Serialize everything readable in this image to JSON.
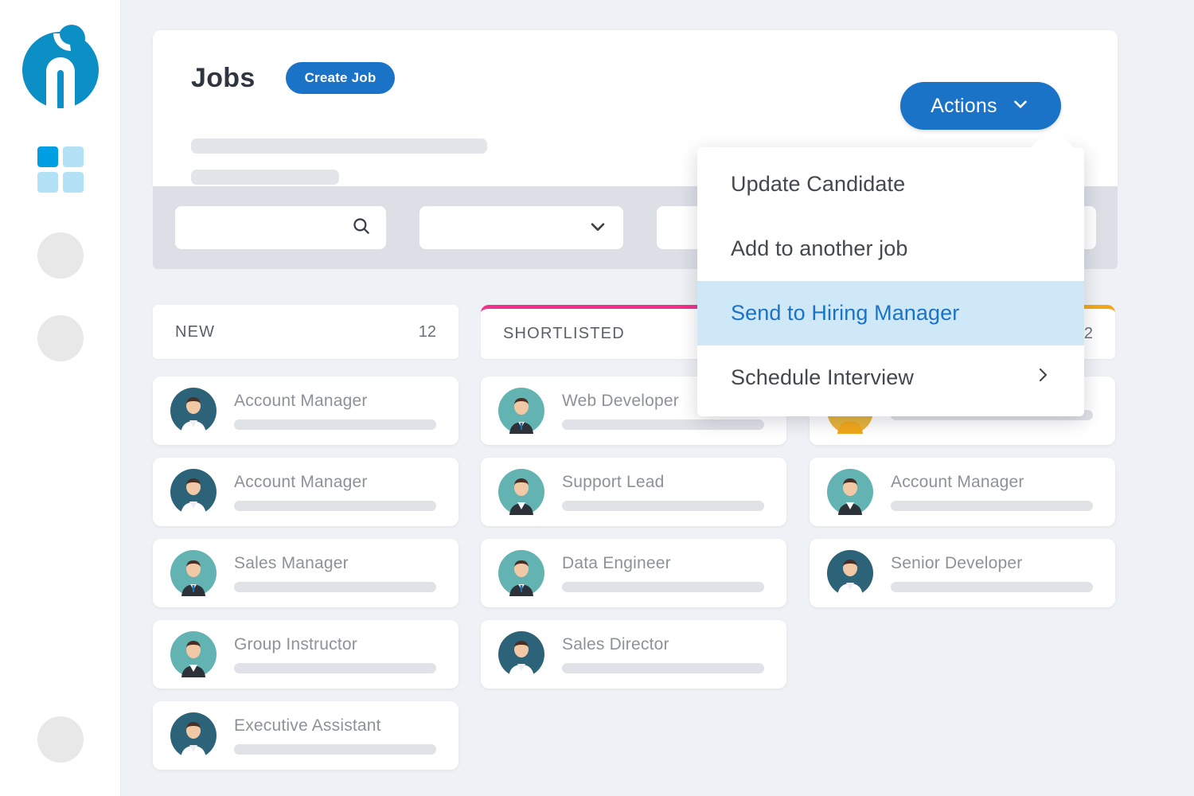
{
  "sidebar": {
    "logo_name": "recruiter-logo",
    "items": [
      {
        "name": "apps-grid-icon",
        "type": "grid"
      },
      {
        "name": "nav-placeholder-1",
        "type": "dot"
      },
      {
        "name": "nav-placeholder-2",
        "type": "dot"
      },
      {
        "name": "nav-placeholder-3",
        "type": "dot"
      }
    ]
  },
  "header": {
    "title": "Jobs",
    "create_job_label": "Create Job"
  },
  "filters": {
    "search_placeholder": "",
    "search_value": "",
    "search_icon": "search-icon",
    "select_value": "",
    "select_icon": "chevron-down-icon",
    "third_value": "",
    "fourth_value": ""
  },
  "actions": {
    "label": "Actions",
    "chevron": "chevron-down-icon",
    "menu": [
      {
        "label": "Update Candidate",
        "active": false,
        "submenu": false
      },
      {
        "label": "Add to another job",
        "active": false,
        "submenu": false
      },
      {
        "label": "Send to Hiring Manager",
        "active": true,
        "submenu": false
      },
      {
        "label": "Schedule Interview",
        "active": false,
        "submenu": true,
        "submenu_icon": "chevron-right-icon"
      }
    ]
  },
  "board": {
    "columns": [
      {
        "name": "NEW",
        "count": "12",
        "accent": "none",
        "cards": [
          {
            "title": "Account Manager",
            "avatar_bg": "#2d6379",
            "avatar_type": "female"
          },
          {
            "title": "Account Manager",
            "avatar_bg": "#2d6379",
            "avatar_type": "female"
          },
          {
            "title": "Sales Manager",
            "avatar_bg": "#62b3b2",
            "avatar_type": "male"
          },
          {
            "title": "Group Instructor",
            "avatar_bg": "#62b3b2",
            "avatar_type": "female"
          },
          {
            "title": "Executive Assistant",
            "avatar_bg": "#2d6379",
            "avatar_type": "female"
          }
        ]
      },
      {
        "name": "SHORTLISTED",
        "count": "",
        "accent": "#f0328c",
        "cards": [
          {
            "title": "Web Developer",
            "avatar_bg": "#62b3b2",
            "avatar_type": "male"
          },
          {
            "title": "Support Lead",
            "avatar_bg": "#62b3b2",
            "avatar_type": "female"
          },
          {
            "title": "Data Engineer",
            "avatar_bg": "#62b3b2",
            "avatar_type": "male"
          },
          {
            "title": "Sales Director",
            "avatar_bg": "#2d6379",
            "avatar_type": "female"
          }
        ]
      },
      {
        "name": "",
        "count": "2",
        "accent": "#f2a71b",
        "cards": [
          {
            "title": "",
            "avatar_bg": "#e8b43c",
            "avatar_type": "female"
          },
          {
            "title": "Account Manager",
            "avatar_bg": "#62b3b2",
            "avatar_type": "female"
          },
          {
            "title": "Senior Developer",
            "avatar_bg": "#2d6379",
            "avatar_type": "female"
          }
        ]
      }
    ]
  },
  "colors": {
    "brand_blue": "#1a73c7",
    "logo_blue": "#0b8fc4",
    "accent_pink": "#f0328c",
    "accent_amber": "#f2a71b",
    "highlight_blue": "#cfe8f7",
    "page_bg": "#eef1f5"
  }
}
